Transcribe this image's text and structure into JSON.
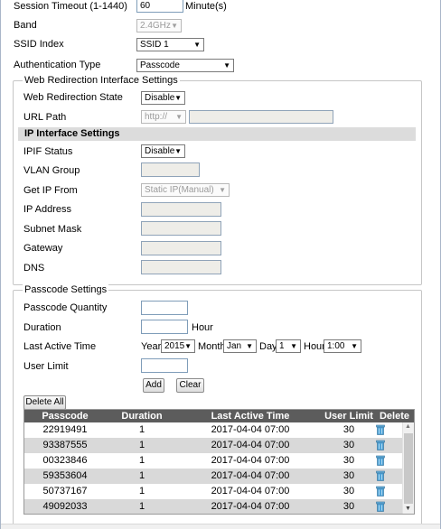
{
  "session": {
    "label": "Session Timeout (1-1440)",
    "value": "60",
    "unit": "Minute(s)"
  },
  "band": {
    "label": "Band",
    "value": "2.4GHz"
  },
  "ssid": {
    "label": "SSID Index",
    "value": "SSID 1"
  },
  "auth": {
    "label": "Authentication Type",
    "value": "Passcode"
  },
  "web": {
    "legend": "Web Redirection Interface Settings",
    "state_label": "Web Redirection State",
    "state_value": "Disable",
    "url_label": "URL Path",
    "url_scheme": "http://",
    "ip_header": "IP Interface Settings",
    "ipif_label": "IPIF Status",
    "ipif_value": "Disable",
    "vlan_label": "VLAN Group",
    "getip_label": "Get IP From",
    "getip_value": "Static IP(Manual)",
    "ip_label": "IP Address",
    "mask_label": "Subnet Mask",
    "gw_label": "Gateway",
    "dns_label": "DNS"
  },
  "passcode": {
    "legend": "Passcode Settings",
    "qty_label": "Passcode Quantity",
    "dur_label": "Duration",
    "dur_unit": "Hour",
    "lat_label": "Last Active Time",
    "year_label": "Year",
    "year_value": "2015",
    "month_label": "Month",
    "month_value": "Jan",
    "day_label": "Day",
    "day_value": "1",
    "hour_label": "Hour",
    "hour_value": "1:00",
    "limit_label": "User Limit",
    "add_label": "Add",
    "clear_label": "Clear",
    "delete_all_label": "Delete All"
  },
  "table": {
    "headers": [
      "Passcode",
      "Duration",
      "Last Active Time",
      "User Limit",
      "Delete"
    ],
    "rows": [
      {
        "passcode": "22919491",
        "duration": "1",
        "time": "2017-04-04 07:00",
        "limit": "30"
      },
      {
        "passcode": "93387555",
        "duration": "1",
        "time": "2017-04-04 07:00",
        "limit": "30"
      },
      {
        "passcode": "00323846",
        "duration": "1",
        "time": "2017-04-04 07:00",
        "limit": "30"
      },
      {
        "passcode": "59353604",
        "duration": "1",
        "time": "2017-04-04 07:00",
        "limit": "30"
      },
      {
        "passcode": "50737167",
        "duration": "1",
        "time": "2017-04-04 07:00",
        "limit": "30"
      },
      {
        "passcode": "49092033",
        "duration": "1",
        "time": "2017-04-04 07:00",
        "limit": "30"
      }
    ]
  },
  "icons": {
    "dropdown": "chevron-down-icon",
    "delete": "trash-icon",
    "scroll_up": "arrow-up-icon",
    "scroll_down": "arrow-down-icon"
  },
  "colors": {
    "table_header": "#5c5c5c",
    "row_alt": "#d9d9d9",
    "field_border": "#7f9db9"
  }
}
